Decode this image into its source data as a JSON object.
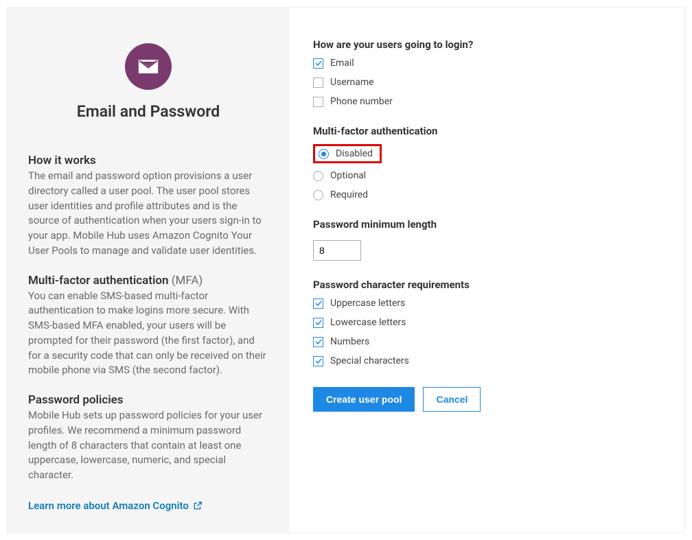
{
  "left": {
    "title": "Email and Password",
    "how_it_works_heading": "How it works",
    "how_it_works_body": "The email and password option provisions a user directory called a user pool. The user pool stores user identities and profile attributes and is the source of authentication when your users sign-in to your app. Mobile Hub uses Amazon Cognito Your User Pools to manage and validate user identities.",
    "mfa_heading": "Multi-factor authentication",
    "mfa_heading_suffix": " (MFA)",
    "mfa_body": "You can enable SMS-based multi-factor authentication to make logins more secure. With SMS-based MFA enabled, your users will be prompted for their password (the first factor), and for a security code that can only be received on their mobile phone via SMS (the second factor).",
    "policies_heading": "Password policies",
    "policies_body": "Mobile Hub sets up password policies for your user profiles. We recommend a minimum password length of 8 characters that contain at least one uppercase, lowercase, numeric, and special character.",
    "learn_link": "Learn more about Amazon Cognito"
  },
  "login": {
    "heading": "How are your users going to login?",
    "email": "Email",
    "username": "Username",
    "phone": "Phone number"
  },
  "mfa": {
    "heading": "Multi-factor authentication",
    "disabled": "Disabled",
    "optional": "Optional",
    "required": "Required"
  },
  "pwd_len": {
    "heading": "Password minimum length",
    "value": "8"
  },
  "pwd_req": {
    "heading": "Password character requirements",
    "upper": "Uppercase letters",
    "lower": "Lowercase letters",
    "numbers": "Numbers",
    "special": "Special characters"
  },
  "buttons": {
    "create": "Create user pool",
    "cancel": "Cancel"
  }
}
